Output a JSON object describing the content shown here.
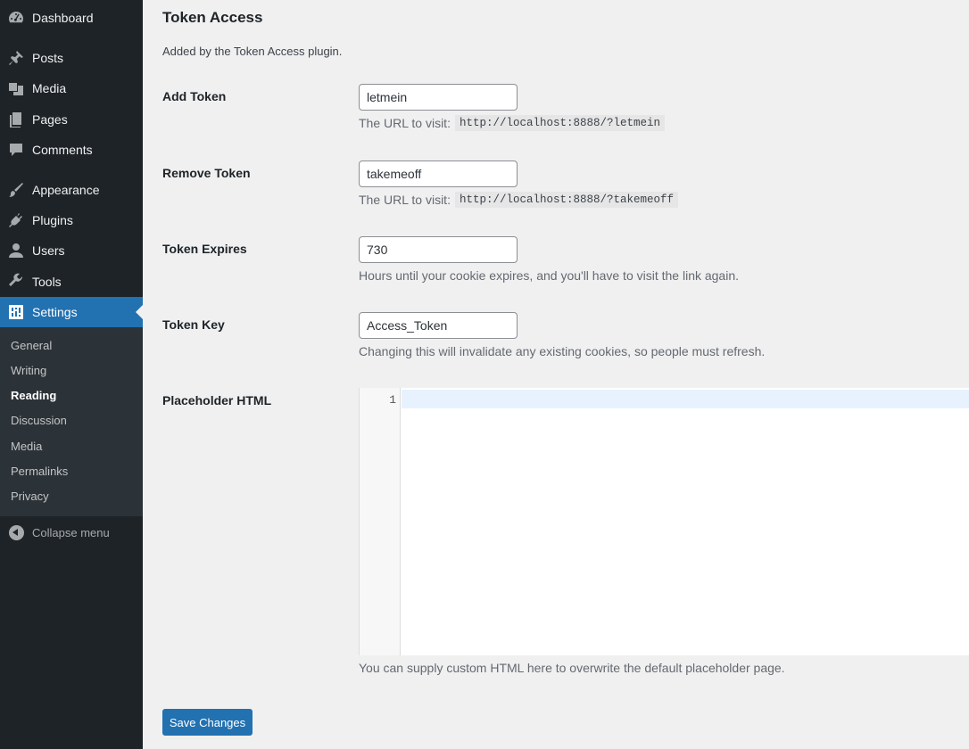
{
  "sidebar": {
    "items": [
      {
        "label": "Dashboard",
        "icon": "dashboard-icon"
      },
      {
        "label": "Posts",
        "icon": "pin-icon"
      },
      {
        "label": "Media",
        "icon": "media-icon"
      },
      {
        "label": "Pages",
        "icon": "pages-icon"
      },
      {
        "label": "Comments",
        "icon": "comments-icon"
      },
      {
        "label": "Appearance",
        "icon": "brush-icon"
      },
      {
        "label": "Plugins",
        "icon": "plugin-icon"
      },
      {
        "label": "Users",
        "icon": "user-icon"
      },
      {
        "label": "Tools",
        "icon": "wrench-icon"
      },
      {
        "label": "Settings",
        "icon": "settings-icon",
        "active": true
      }
    ],
    "submenu": [
      "General",
      "Writing",
      "Reading",
      "Discussion",
      "Media",
      "Permalinks",
      "Privacy"
    ],
    "current_submenu": "Reading",
    "collapse_label": "Collapse menu"
  },
  "section": {
    "title": "Token Access",
    "description": "Added by the Token Access plugin."
  },
  "fields": {
    "add_token": {
      "label": "Add Token",
      "value": "letmein",
      "help_prefix": "The URL to visit:",
      "help_code": "http://localhost:8888/?letmein"
    },
    "remove_token": {
      "label": "Remove Token",
      "value": "takemeoff",
      "help_prefix": "The URL to visit:",
      "help_code": "http://localhost:8888/?takemeoff"
    },
    "token_expires": {
      "label": "Token Expires",
      "value": "730",
      "help": "Hours until your cookie expires, and you'll have to visit the link again."
    },
    "token_key": {
      "label": "Token Key",
      "value": "Access_Token",
      "help": "Changing this will invalidate any existing cookies, so people must refresh."
    },
    "placeholder_html": {
      "label": "Placeholder HTML",
      "line_number": "1",
      "help": "You can supply custom HTML here to overwrite the default placeholder page."
    }
  },
  "save_label": "Save Changes",
  "colors": {
    "sidebar_bg": "#1d2327",
    "submenu_bg": "#2c3338",
    "accent": "#2271b1",
    "page_bg": "#f0f0f1"
  }
}
